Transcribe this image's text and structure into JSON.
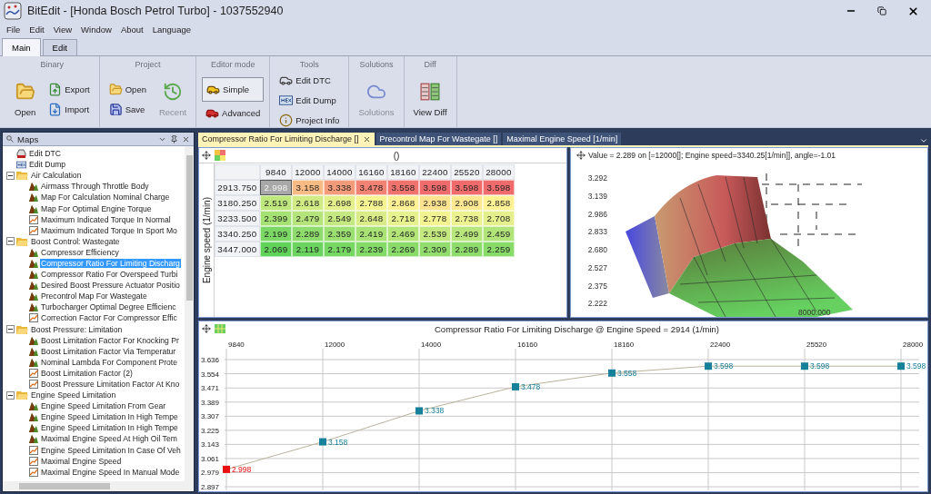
{
  "window": {
    "title": "BitEdit - [Honda Bosch Petrol Turbo] - 1037552940"
  },
  "menu": [
    "File",
    "Edit",
    "View",
    "Window",
    "About",
    "Language"
  ],
  "ribbon_tabs": [
    {
      "label": "Main",
      "selected": true
    },
    {
      "label": "Edit",
      "selected": false
    }
  ],
  "ribbon_groups": [
    {
      "title": "Binary",
      "columns": [
        [
          {
            "label": "Open",
            "kind": "large",
            "disabled": false
          }
        ],
        [
          {
            "label": "Export",
            "kind": "small",
            "disabled": false
          },
          {
            "label": "Import",
            "kind": "small",
            "disabled": false
          }
        ]
      ]
    },
    {
      "title": "Project",
      "columns": [
        [
          {
            "label": "Open",
            "kind": "small",
            "disabled": false
          },
          {
            "label": "Save",
            "kind": "small",
            "disabled": false
          }
        ],
        [
          {
            "label": "Recent",
            "kind": "large",
            "disabled": true
          }
        ]
      ]
    },
    {
      "title": "Editor mode",
      "columns": [
        [
          {
            "label": "Simple",
            "kind": "small",
            "disabled": false,
            "selected": true
          },
          {
            "label": "Advanced",
            "kind": "small",
            "disabled": false,
            "selected": false
          }
        ]
      ]
    },
    {
      "title": "Tools",
      "columns": [
        [
          {
            "label": "Edit DTC",
            "kind": "small",
            "disabled": false
          },
          {
            "label": "Edit Dump",
            "kind": "small",
            "disabled": false
          },
          {
            "label": "Project Info",
            "kind": "small",
            "disabled": false
          }
        ]
      ]
    },
    {
      "title": "Solutions",
      "columns": [
        [
          {
            "label": "Solutions",
            "kind": "large",
            "disabled": true
          }
        ]
      ]
    },
    {
      "title": "Diff",
      "columns": [
        [
          {
            "label": "View Diff",
            "kind": "large",
            "disabled": false
          }
        ]
      ]
    }
  ],
  "maps_panel": {
    "title": "Maps",
    "tree": [
      {
        "label": "Edit DTC",
        "kind": "dtc",
        "selected": false
      },
      {
        "label": "Edit Dump",
        "kind": "hex",
        "selected": false
      },
      {
        "label": "Air Calculation",
        "kind": "folder",
        "expanded": true,
        "selected": false,
        "children": [
          {
            "label": "Airmass Through Throttle Body",
            "kind": "map3d",
            "selected": false
          },
          {
            "label": "Map For Calculation Nominal Charge",
            "kind": "map3d",
            "selected": false
          },
          {
            "label": "Map For Optimal Engine Torque",
            "kind": "map3d",
            "selected": false
          },
          {
            "label": "Maximum Indicated Torque In Normal",
            "kind": "map2d",
            "selected": false
          },
          {
            "label": "Maximum Indicated Torque In Sport Mo",
            "kind": "map2d",
            "selected": false
          }
        ]
      },
      {
        "label": "Boost Control: Wastegate",
        "kind": "folder",
        "expanded": true,
        "selected": false,
        "children": [
          {
            "label": "Compressor Efficiency",
            "kind": "map3d",
            "selected": false
          },
          {
            "label": "Compressor Ratio For Limiting Discharg",
            "kind": "map3d",
            "selected": true
          },
          {
            "label": "Compressor Ratio For Overspeed Turbi",
            "kind": "map3d",
            "selected": false
          },
          {
            "label": "Desired Boost Pressure Actuator Positio",
            "kind": "map3d",
            "selected": false
          },
          {
            "label": "Precontrol Map For Wastegate",
            "kind": "map3d",
            "selected": false
          },
          {
            "label": "Turbocharger Optimal Degree Efficienc",
            "kind": "map3d",
            "selected": false
          },
          {
            "label": "Correction Factor For Compressor Effic",
            "kind": "map2d",
            "selected": false
          }
        ]
      },
      {
        "label": "Boost Pressure: Limitation",
        "kind": "folder",
        "expanded": true,
        "selected": false,
        "children": [
          {
            "label": "Boost Limitation Factor For Knocking Pr",
            "kind": "map3d",
            "selected": false
          },
          {
            "label": "Boost Limitation Factor Via Temperatur",
            "kind": "map3d",
            "selected": false
          },
          {
            "label": "Nominal Lambda For Component Prote",
            "kind": "map3d",
            "selected": false
          },
          {
            "label": "Boost Limitation Factor (2)",
            "kind": "map2d",
            "selected": false
          },
          {
            "label": "Boost Pressure Limitation Factor At Kno",
            "kind": "map2d",
            "selected": false
          }
        ]
      },
      {
        "label": "Engine Speed Limitation",
        "kind": "folder",
        "expanded": true,
        "selected": false,
        "children": [
          {
            "label": "Engine Speed Limitation From Gear",
            "kind": "map3d",
            "selected": false
          },
          {
            "label": "Engine Speed Limitation In High Tempe",
            "kind": "map3d",
            "selected": false
          },
          {
            "label": "Engine Speed Limitation In High Tempe",
            "kind": "map3d",
            "selected": false
          },
          {
            "label": "Maximal Engine Speed At High Oil Tem",
            "kind": "map3d",
            "selected": false
          },
          {
            "label": "Engine Speed Limitation In Case Of Veh",
            "kind": "map2d",
            "selected": false
          },
          {
            "label": "Maximal Engine Speed",
            "kind": "map2d",
            "selected": false
          },
          {
            "label": "Maximal Engine Speed In Manual Mode",
            "kind": "map2d",
            "selected": false
          }
        ]
      }
    ]
  },
  "document_tabs": [
    {
      "label": "Compressor Ratio For Limiting Discharge []",
      "selected": true
    },
    {
      "label": "Precontrol Map For Wastegate []",
      "selected": false
    },
    {
      "label": "Maximal Engine Speed [1/min]",
      "selected": false
    }
  ],
  "table": {
    "title": "()",
    "row_axis": "Engine speed (1/min)",
    "columns": [
      "9840",
      "12000",
      "14000",
      "16160",
      "18160",
      "22400",
      "25520",
      "28000"
    ],
    "rows": [
      {
        "label": "2913.750",
        "cells": [
          {
            "value": "2.998",
            "selected": true
          },
          {
            "value": "3.158",
            "selected": false
          },
          {
            "value": "3.338",
            "selected": false
          },
          {
            "value": "3.478",
            "selected": false
          },
          {
            "value": "3.558",
            "selected": false
          },
          {
            "value": "3.598",
            "selected": false
          },
          {
            "value": "3.598",
            "selected": false
          },
          {
            "value": "3.598",
            "selected": false
          }
        ]
      },
      {
        "label": "3180.250",
        "cells": [
          {
            "value": "2.519",
            "selected": false
          },
          {
            "value": "2.618",
            "selected": false
          },
          {
            "value": "2.698",
            "selected": false
          },
          {
            "value": "2.788",
            "selected": false
          },
          {
            "value": "2.868",
            "selected": false
          },
          {
            "value": "2.938",
            "selected": false
          },
          {
            "value": "2.908",
            "selected": false
          },
          {
            "value": "2.858",
            "selected": false
          }
        ]
      },
      {
        "label": "3233.500",
        "cells": [
          {
            "value": "2.399",
            "selected": false
          },
          {
            "value": "2.479",
            "selected": false
          },
          {
            "value": "2.549",
            "selected": false
          },
          {
            "value": "2.648",
            "selected": false
          },
          {
            "value": "2.718",
            "selected": false
          },
          {
            "value": "2.778",
            "selected": false
          },
          {
            "value": "2.738",
            "selected": false
          },
          {
            "value": "2.708",
            "selected": false
          }
        ]
      },
      {
        "label": "3340.250",
        "cells": [
          {
            "value": "2.199",
            "selected": false
          },
          {
            "value": "2.289",
            "selected": false
          },
          {
            "value": "2.359",
            "selected": false
          },
          {
            "value": "2.419",
            "selected": false
          },
          {
            "value": "2.469",
            "selected": false
          },
          {
            "value": "2.539",
            "selected": false
          },
          {
            "value": "2.499",
            "selected": false
          },
          {
            "value": "2.459",
            "selected": false
          }
        ]
      },
      {
        "label": "3447.000",
        "cells": [
          {
            "value": "2.069",
            "selected": false
          },
          {
            "value": "2.119",
            "selected": false
          },
          {
            "value": "2.179",
            "selected": false
          },
          {
            "value": "2.239",
            "selected": false
          },
          {
            "value": "2.269",
            "selected": false
          },
          {
            "value": "2.309",
            "selected": false
          },
          {
            "value": "2.289",
            "selected": false
          },
          {
            "value": "2.259",
            "selected": false
          }
        ]
      }
    ]
  },
  "surface_plot": {
    "readout": "Value = 2.289  on [=12000[]; Engine speed=3340.25[1/min]], angle=-1.01",
    "z_ticks": [
      "3.292",
      "3.139",
      "2.986",
      "2.833",
      "2.680",
      "2.527",
      "2.375",
      "2.222"
    ],
    "corner_label": "8000.000"
  },
  "line_chart": {
    "title": "Compressor Ratio For Limiting Discharge @ Engine Speed = 2914 (1/min)",
    "chart_data": {
      "type": "line",
      "categories": [
        "9840",
        "12000",
        "14000",
        "16160",
        "18160",
        "22400",
        "25520",
        "28000"
      ],
      "series": [
        {
          "color": "#17809a",
          "marker": "square",
          "values": [
            2.998,
            3.158,
            3.338,
            3.478,
            3.558,
            3.598,
            3.598,
            3.598
          ]
        }
      ],
      "ylim": [
        2.897,
        3.636
      ],
      "yticks": [
        2.897,
        2.979,
        3.061,
        3.143,
        3.225,
        3.307,
        3.389,
        3.471,
        3.554,
        3.636
      ],
      "grid": true,
      "data_labels": true
    }
  }
}
